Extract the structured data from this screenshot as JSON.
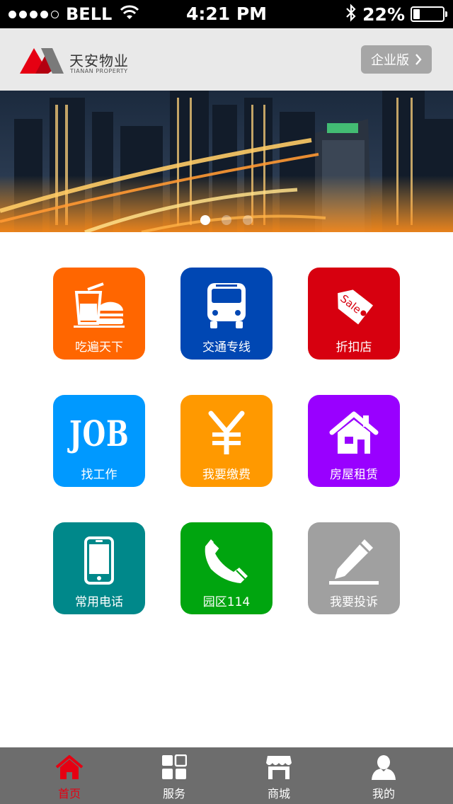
{
  "status_bar": {
    "carrier": "BELL",
    "time": "4:21 PM",
    "battery": "22%",
    "battery_level": 0.22,
    "signal_bars_filled": 4,
    "signal_bars_total": 5
  },
  "header": {
    "brand_cn": "天安物业",
    "brand_en": "TIANAN PROPERTY",
    "enterprise_button": "企业版",
    "logo_colors": {
      "red": "#e60012",
      "gray": "#7a7a7a"
    }
  },
  "banner": {
    "image_subject": "night city skyline",
    "slide_count": 3,
    "active_slide": 1
  },
  "services": [
    {
      "label": "吃遍天下",
      "icon": "food-drink-icon",
      "color": "#ff6600"
    },
    {
      "label": "交通专线",
      "icon": "bus-icon",
      "color": "#0047b3"
    },
    {
      "label": "折扣店",
      "icon": "sale-tag-icon",
      "color": "#d7000f"
    },
    {
      "label": "找工作",
      "icon": "job-icon",
      "icon_text": "JOB",
      "color": "#0099ff"
    },
    {
      "label": "我要缴费",
      "icon": "yen-icon",
      "color": "#ff9900"
    },
    {
      "label": "房屋租赁",
      "icon": "house-icon",
      "color": "#9900ff"
    },
    {
      "label": "常用电话",
      "icon": "mobile-phone-icon",
      "color": "#00888a"
    },
    {
      "label": "园区114",
      "icon": "phone-handset-icon",
      "color": "#00a50f"
    },
    {
      "label": "我要投诉",
      "icon": "pencil-icon",
      "color": "#a0a0a0"
    }
  ],
  "tabbar": {
    "active_color": "#e60012",
    "items": [
      {
        "label": "首页",
        "icon": "home-icon",
        "active": true
      },
      {
        "label": "服务",
        "icon": "grid-icon",
        "active": false
      },
      {
        "label": "商城",
        "icon": "store-icon",
        "active": false
      },
      {
        "label": "我的",
        "icon": "person-icon",
        "active": false
      }
    ]
  }
}
